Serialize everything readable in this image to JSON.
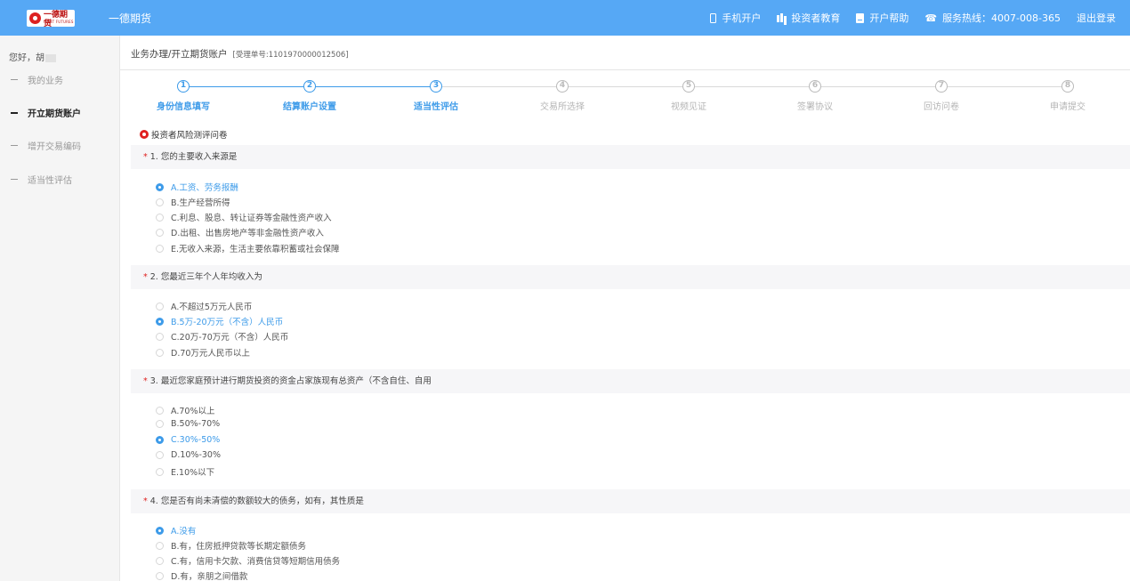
{
  "header": {
    "logo_text": "一德期货",
    "logo_sub": "FIRST FUTURES",
    "brand": "一德期货",
    "nav": [
      {
        "label": "手机开户",
        "icon": "phone-icon"
      },
      {
        "label": "投资者教育",
        "icon": "book-icon"
      },
      {
        "label": "开户帮助",
        "icon": "help-icon"
      },
      {
        "label": "服务热线：4007-008-365",
        "icon": "telephone-icon"
      },
      {
        "label": "退出登录"
      }
    ]
  },
  "sidebar": {
    "greeting": "您好，胡",
    "items": [
      {
        "label": "我的业务",
        "active": false
      },
      {
        "label": "开立期货账户",
        "active": true
      },
      {
        "label": "增开交易编码",
        "active": false
      },
      {
        "label": "适当性评估",
        "active": false
      }
    ]
  },
  "breadcrumb": {
    "path": "业务办理/开立期货账户",
    "ticket": "[受理单号:1101970000012506]"
  },
  "steps": [
    {
      "num": "1",
      "label": "身份信息填写",
      "done": true
    },
    {
      "num": "2",
      "label": "结算账户设置",
      "done": true
    },
    {
      "num": "3",
      "label": "适当性评估",
      "done": true
    },
    {
      "num": "4",
      "label": "交易所选择",
      "done": false
    },
    {
      "num": "5",
      "label": "视频见证",
      "done": false
    },
    {
      "num": "6",
      "label": "签署协议",
      "done": false
    },
    {
      "num": "7",
      "label": "回访问卷",
      "done": false
    },
    {
      "num": "8",
      "label": "申请提交",
      "done": false
    }
  ],
  "questionnaire": {
    "title": "投资者风险测评问卷",
    "questions": [
      {
        "title": "1. 您的主要收入来源是",
        "options": [
          {
            "label": "A.工资、劳务报酬",
            "selected": true
          },
          {
            "label": "B.生产经营所得",
            "selected": false
          },
          {
            "label": "C.利息、股息、转让证券等金融性资产收入",
            "selected": false
          },
          {
            "label": "D.出租、出售房地产等非金融性资产收入",
            "selected": false
          },
          {
            "label": "E.无收入来源，生活主要依靠积蓄或社会保障",
            "selected": false
          }
        ]
      },
      {
        "title": "2. 您最近三年个人年均收入为",
        "options": [
          {
            "label": "A.不超过5万元人民币",
            "selected": false
          },
          {
            "label": "B.5万-20万元（不含）人民币",
            "selected": true
          },
          {
            "label": "C.20万-70万元（不含）人民币",
            "selected": false
          },
          {
            "label": "D.70万元人民币以上",
            "selected": false
          }
        ]
      },
      {
        "title": "3. 最近您家庭预计进行期货投资的资金占家族现有总资产（不含自住、自用",
        "options": [
          {
            "label": "A.70%以上",
            "selected": false
          },
          {
            "label": "B.50%-70%",
            "selected": false
          },
          {
            "label": "C.30%-50%",
            "selected": true
          },
          {
            "label": "D.10%-30%",
            "selected": false
          },
          {
            "label": "E.10%以下",
            "selected": false
          }
        ]
      },
      {
        "title": "4. 您是否有尚未清偿的数额较大的债务，如有，其性质是",
        "options": [
          {
            "label": "A.没有",
            "selected": true
          },
          {
            "label": "B.有，住房抵押贷款等长期定额债务",
            "selected": false
          },
          {
            "label": "C.有，信用卡欠款、消费信贷等短期信用债务",
            "selected": false
          },
          {
            "label": "D.有，亲朋之间借款",
            "selected": false
          }
        ]
      }
    ]
  },
  "colors": {
    "topbar": "#56a8f5",
    "accent": "#3d9be9",
    "required": "#e0201f"
  }
}
